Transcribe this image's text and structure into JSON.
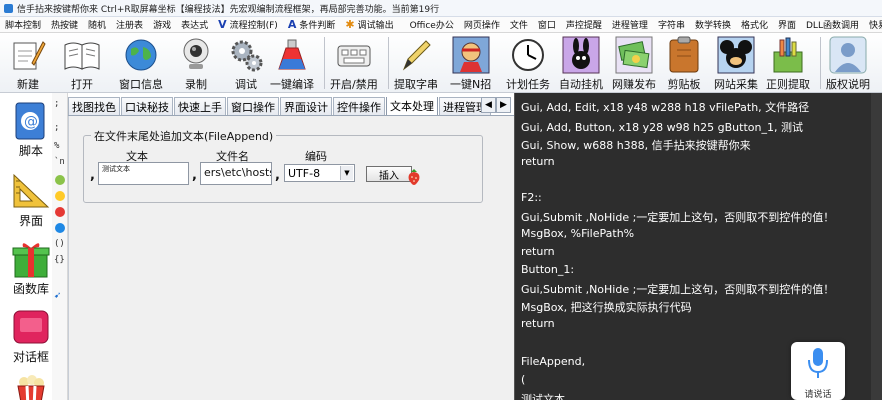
{
  "window": {
    "title": "信手拈来按键帮你来 Ctrl+R取屏幕坐标【编程技法】先宏观编制流程框架，再局部完善功能。当前第19行"
  },
  "menu": {
    "items": [
      "脚本控制",
      "热按键",
      "随机",
      "注册表",
      "游戏",
      "表达式",
      "流程控制(F)",
      "条件判断",
      "调试输出",
      "Office办公",
      "网页操作",
      "文件",
      "窗口",
      "声控提醒",
      "进程管理",
      "字符串",
      "数学转换",
      "格式化",
      "界面",
      "DLL函数调用",
      "快易通"
    ]
  },
  "toolbar": {
    "buttons": [
      {
        "label": "新建",
        "icon": "new-file-pen-icon"
      },
      {
        "label": "打开",
        "icon": "open-book-icon"
      },
      {
        "label": "窗口信息",
        "icon": "globe-icon"
      },
      {
        "label": "录制",
        "icon": "webcam-icon"
      },
      {
        "label": "调试",
        "icon": "gears-icon"
      },
      {
        "label": "一键编译",
        "icon": "potion-icon"
      },
      {
        "label": "开启/禁用",
        "icon": "keyboard-icon"
      },
      {
        "label": "提取字串",
        "icon": "pen-icon"
      },
      {
        "label": "一键N招",
        "icon": "ninja-icon"
      },
      {
        "label": "计划任务",
        "icon": "clock-icon"
      },
      {
        "label": "自动挂机",
        "icon": "bunny-icon"
      },
      {
        "label": "网赚发布",
        "icon": "money-icon"
      },
      {
        "label": "剪贴板",
        "icon": "clipboard-icon"
      },
      {
        "label": "网站采集",
        "icon": "mouse-icon"
      },
      {
        "label": "正则提取",
        "icon": "tools-icon"
      },
      {
        "label": "版权说明",
        "icon": "person-icon"
      }
    ]
  },
  "leftbar": {
    "buttons": [
      {
        "label": "脚本",
        "icon": "email-script-icon"
      },
      {
        "label": "界面",
        "icon": "ruler-icon"
      },
      {
        "label": "函数库",
        "icon": "gift-box-icon"
      },
      {
        "label": "对话框",
        "icon": "dialog-box-icon"
      },
      {
        "label": "",
        "icon": "popcorn-icon"
      }
    ],
    "symbols": [
      ";",
      ";",
      "%",
      "`n",
      "()",
      "{}"
    ]
  },
  "tabs": {
    "items": [
      "找图找色",
      "口诀秘技",
      "快速上手",
      "窗口操作",
      "界面设计",
      "控件操作",
      "文本处理",
      "进程管理"
    ],
    "active_index": 6
  },
  "file_append": {
    "group_title": "在文件末尾处追加文本(FileAppend)",
    "text_label": "文本",
    "filename_label": "文件名",
    "encoding_label": "编码",
    "text_value": "测试文本",
    "filename_value": "ers\\etc\\hosts",
    "encoding_value": "UTF-8",
    "insert_button": "插入"
  },
  "code": {
    "lines": [
      "Gui, Add, Edit, x18 y48 w288 h18 vFilePath, 文件路径",
      "Gui, Add, Button, x18 y28 w98 h25 gButton_1, 测试",
      "Gui, Show, w688 h388, 信手拈来按键帮你来",
      "return",
      "",
      "F2::",
      "  Gui,Submit ,NoHide  ;一定要加上这句，否则取不到控件的值！",
      "  MsgBox, %FilePath%",
      "return",
      "Button_1:",
      "  Gui,Submit ,NoHide  ;一定要加上这句，否则取不到控件的值！",
      "  MsgBox, 把这行换成实际执行代码",
      "return",
      "",
      "FileAppend,",
      "(",
      "测试文本"
    ]
  },
  "voice": {
    "label": "请说话"
  },
  "colors": {
    "code_bg": "#2d2d2d",
    "code_fg": "#ffffff",
    "panel_bg": "#f0f0f0"
  }
}
